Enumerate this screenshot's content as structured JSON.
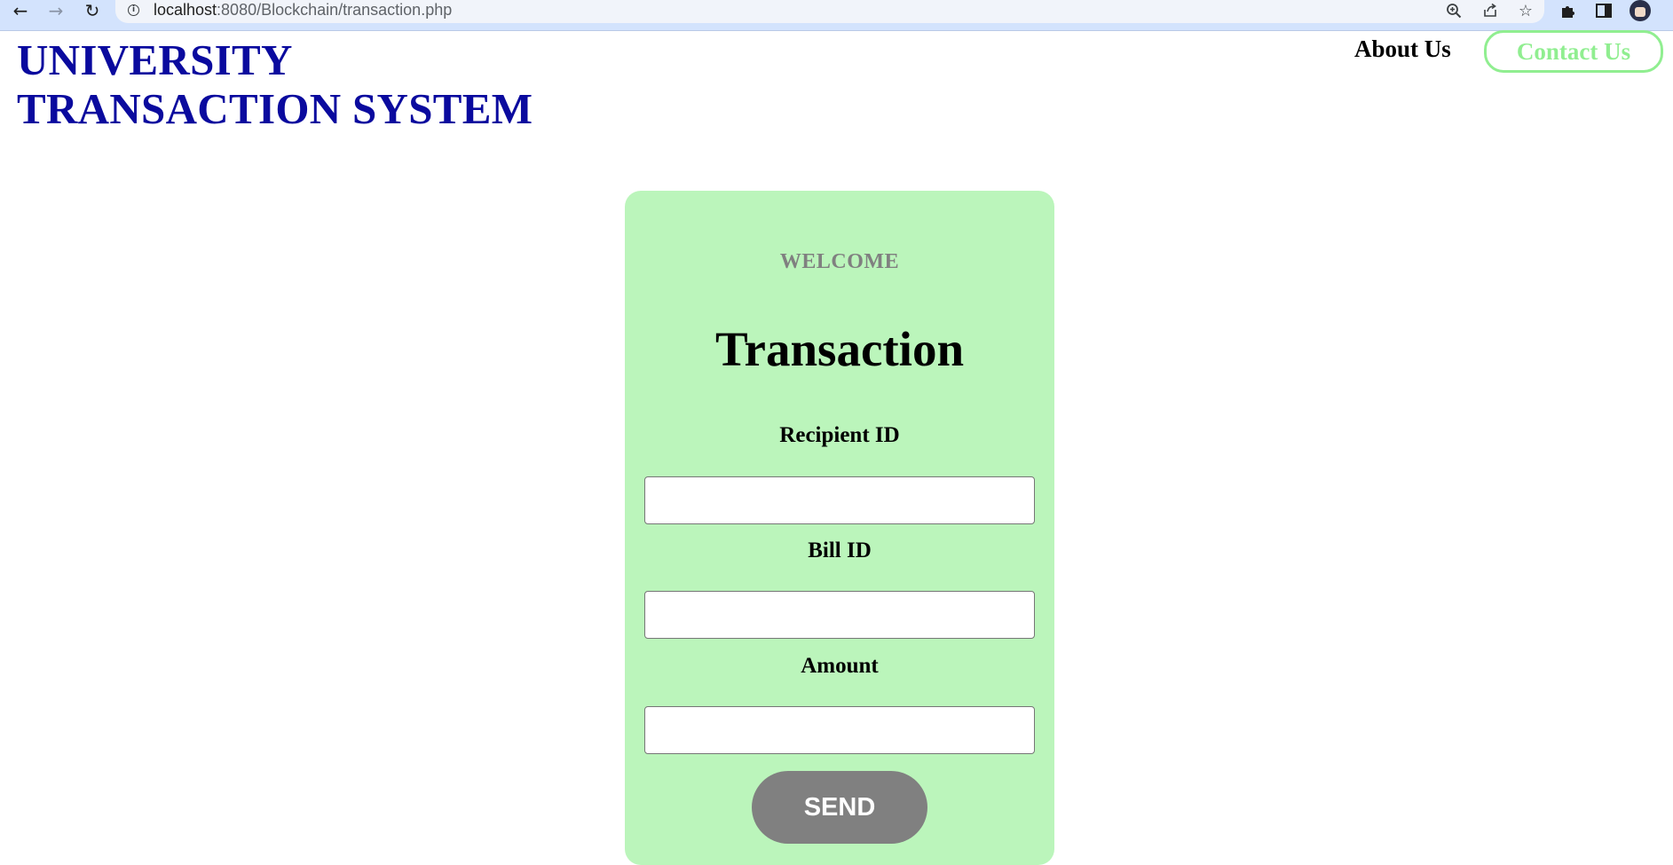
{
  "browser": {
    "url_host": "localhost",
    "url_path": ":8080/Blockchain/transaction.php",
    "icons": {
      "back": "back-arrow-icon",
      "forward": "forward-arrow-icon",
      "reload": "reload-icon",
      "site_info": "info-icon",
      "zoom": "zoom-icon",
      "share": "share-icon",
      "bookmark": "star-icon",
      "extensions": "puzzle-icon",
      "side_panel": "side-panel-icon",
      "profile": "avatar"
    }
  },
  "header": {
    "title_line1": "UNIVERSITY",
    "title_line2": "TRANSACTION SYSTEM",
    "nav": {
      "about": "About Us",
      "contact": "Contact Us"
    }
  },
  "form": {
    "welcome": "WELCOME",
    "title": "Transaction",
    "fields": [
      {
        "label": "Recipient ID",
        "value": "",
        "placeholder": ""
      },
      {
        "label": "Bill ID",
        "value": "",
        "placeholder": ""
      },
      {
        "label": "Amount",
        "value": "",
        "placeholder": ""
      }
    ],
    "submit_label": "SEND"
  },
  "colors": {
    "chrome_bar": "#d3e3fd",
    "title": "#0a0a9e",
    "accent_green": "#90ee90",
    "card_background": "#bbf5bb",
    "welcome_text": "#808080",
    "button_background": "#808080",
    "button_text": "#ffffff"
  }
}
